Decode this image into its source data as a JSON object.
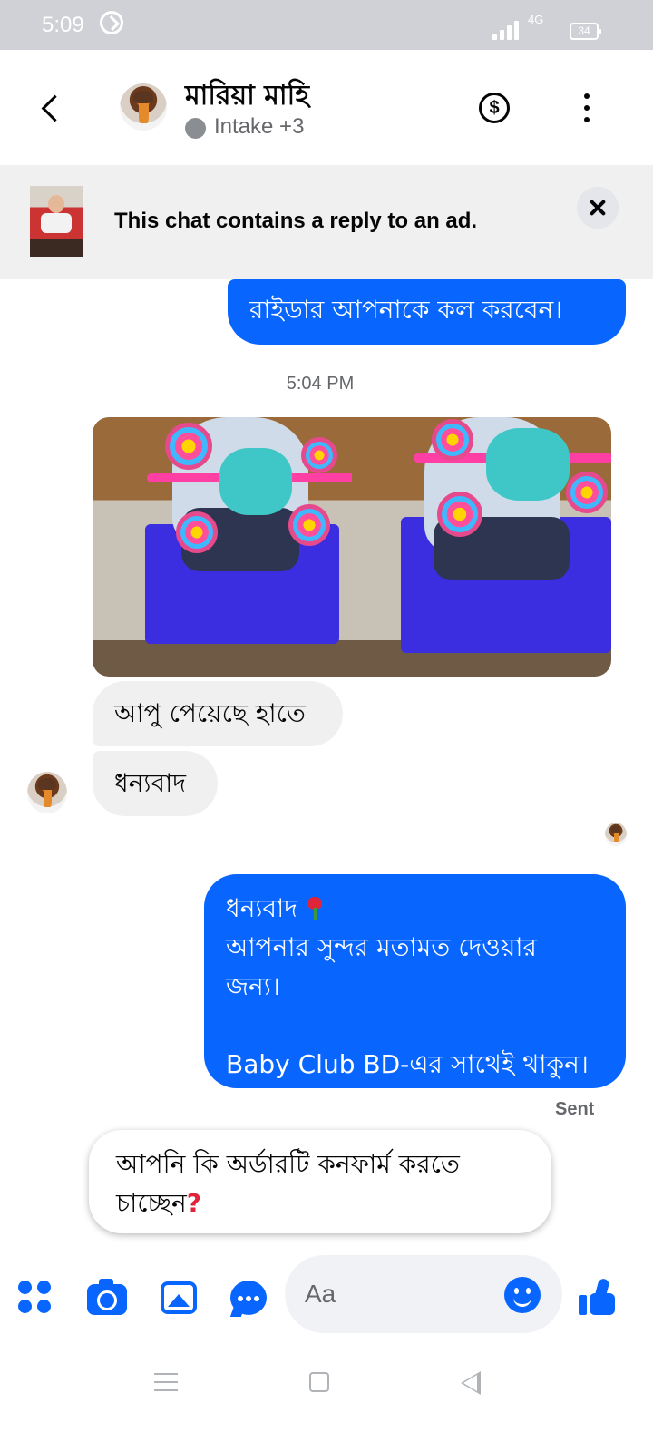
{
  "status_bar": {
    "time": "5:09",
    "network": "4G",
    "battery": "34",
    "icons": [
      "sync-icon",
      "signal-icon",
      "battery-icon"
    ]
  },
  "header": {
    "contact_name": "মারিয়া মাহি",
    "status_label": "Intake +3",
    "icons": [
      "back-arrow-icon",
      "dollar-icon",
      "more-vertical-icon"
    ]
  },
  "ad_banner": {
    "text": "This chat contains a reply to an ad.",
    "close_icon": "close-icon"
  },
  "messages": [
    {
      "direction": "outgoing",
      "text": "রাইডার আপনাকে কল করবেন।"
    },
    {
      "type": "timestamp",
      "text": "5:04 PM"
    },
    {
      "direction": "incoming",
      "type": "photos",
      "count": 2
    },
    {
      "direction": "incoming",
      "text": "আপু পেয়েছে হাতে"
    },
    {
      "direction": "incoming",
      "text": "ধন্যবাদ"
    },
    {
      "direction": "outgoing",
      "lines": [
        "ধন্যবাদ",
        "আপনার সুন্দর মতামত দেওয়ার",
        "জন্য।",
        "",
        "Baby Club BD-এর সাথেই থাকুন।"
      ]
    },
    {
      "type": "status",
      "text": "Sent"
    },
    {
      "direction": "outgoing",
      "lines": [
        "আপনি কি অর্ডারটি কনফার্ম করতে",
        "চাচ্ছেন"
      ]
    }
  ],
  "composer": {
    "placeholder": "Aa",
    "icons": [
      "menu-icon",
      "camera-icon",
      "gallery-icon",
      "chat-bubble-icon",
      "emoji-icon",
      "thumbs-up-icon"
    ]
  },
  "colors": {
    "accent": "#0866ff",
    "incoming_bubble": "#f0f0f0",
    "status_bar": "#d0d1d6",
    "secondary_text": "#65676b"
  }
}
